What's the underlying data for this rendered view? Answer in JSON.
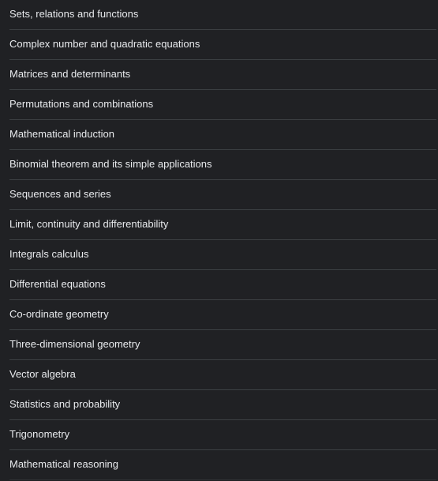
{
  "topics": [
    {
      "label": "Sets, relations and functions"
    },
    {
      "label": "Complex number and quadratic equations"
    },
    {
      "label": "Matrices and determinants"
    },
    {
      "label": "Permutations and combinations"
    },
    {
      "label": "Mathematical induction"
    },
    {
      "label": "Binomial theorem and its simple applications"
    },
    {
      "label": "Sequences and series"
    },
    {
      "label": "Limit, continuity and differentiability"
    },
    {
      "label": "Integrals calculus"
    },
    {
      "label": "Differential equations"
    },
    {
      "label": "Co-ordinate geometry"
    },
    {
      "label": "Three-dimensional geometry"
    },
    {
      "label": "Vector algebra"
    },
    {
      "label": "Statistics and probability"
    },
    {
      "label": "Trigonometry"
    },
    {
      "label": "Mathematical reasoning"
    }
  ],
  "colors": {
    "background": "#202124",
    "text": "#e8eaed",
    "divider": "#3c4043"
  }
}
